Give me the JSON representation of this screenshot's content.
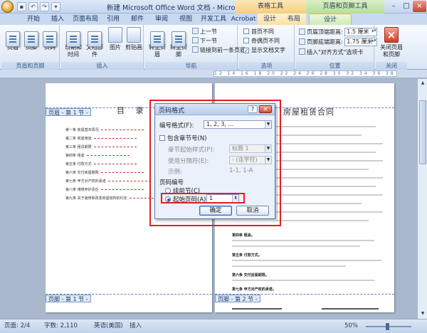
{
  "window": {
    "title": "新建 Microsoft Office Word 文档 - Microsoft Word",
    "context_table": "表格工具",
    "context_header_footer": "页眉和页脚工具",
    "minimize": "–",
    "maximize": "□",
    "close": "×"
  },
  "tabs": {
    "start": "开始",
    "insert": "插入",
    "page_layout": "页面布局",
    "references": "引用",
    "mailings": "邮件",
    "review": "审阅",
    "view": "视图",
    "developer": "开发工具",
    "acrobat": "Acrobat",
    "table_design": "设计",
    "table_layout": "布局",
    "hf_design": "设计"
  },
  "ribbon": {
    "header": "页眉",
    "footer": "页脚",
    "page_number": "页码",
    "group_header_footer": "页眉和页脚",
    "date_time": "日期和时间",
    "doc_parts": "文档部件",
    "picture": "图片",
    "clip_art": "剪贴画",
    "group_insert": "插入",
    "goto_header": "转至页眉",
    "goto_footer": "转至页脚",
    "previous_section": "上一节",
    "next_section": "下一节",
    "link_to_previous": "链接到前一条页眉",
    "group_navigation": "导航",
    "diff_first_page": "首页不同",
    "diff_odd_even": "奇偶页不同",
    "show_doc_text": "显示文档文字",
    "group_options": "选项",
    "header_from_top": "页眉顶端距离:",
    "header_from_top_value": "1.5 厘米",
    "footer_from_bottom": "页脚底端距离:",
    "footer_from_bottom_value": "1.75 厘米",
    "insert_align_tab": "插入\"对齐方式\"选项卡",
    "group_position": "位置",
    "close_header_footer": "关闭页眉和页脚",
    "group_close": "关闭",
    "ruler_text": "12 14 16 18 20 22 24 26 28 30 32 34 36 38 40 42 44 46 48"
  },
  "document": {
    "left_page_title": "目 录",
    "right_page_title": "房屋租赁合同",
    "header_tag_left": "页眉 - 第 1 节 -",
    "footer_tag_left": "页脚 - 第 1 节 -",
    "footer_tag_right": "页脚 - 第 2 节 -",
    "toc": [
      "第一条 房屋基本情况",
      "第二条 房屋用途",
      "第三条 租赁期限",
      "第四条 租金",
      "第五条 付款方式",
      "第六条 交付房屋期限",
      "第七条 甲方对产权的承诺",
      "第八条 维修养护责任",
      "第九条 关于装修和改变房屋结构的约定"
    ],
    "right_sections": [
      "第四条 租金。",
      "第五条 付款方式。",
      "第六条 交付房屋期限。",
      "第七条 甲方对产权的承诺。"
    ]
  },
  "dialog": {
    "title": "页码格式",
    "help": "?",
    "close": "×",
    "number_format_label": "编号格式(F):",
    "number_format_value": "1, 2, 3, …",
    "include_chapter": "包含章节号(N)",
    "chapter_style_label": "章节起始样式(P):",
    "chapter_style_value": "标题 1",
    "separator_label": "使用分隔符(E):",
    "separator_value": "- (连字符)",
    "examples_label": "示例:",
    "examples_value": "1-1, 1-A",
    "page_numbering_label": "页码编号",
    "continue_prev": "续前节(C)",
    "start_at": "起始页码(A):",
    "start_at_value": "1",
    "ok": "确定",
    "cancel": "取消"
  },
  "status": {
    "page": "页面: 2/4",
    "words": "字数: 2,110",
    "language": "英语(美国)",
    "mode": "插入",
    "zoom": "50%"
  },
  "colors": {
    "highlight": "#e0202a",
    "ribbon_bg": "#dae6f5",
    "doc_bg": "#a9b8cc"
  }
}
